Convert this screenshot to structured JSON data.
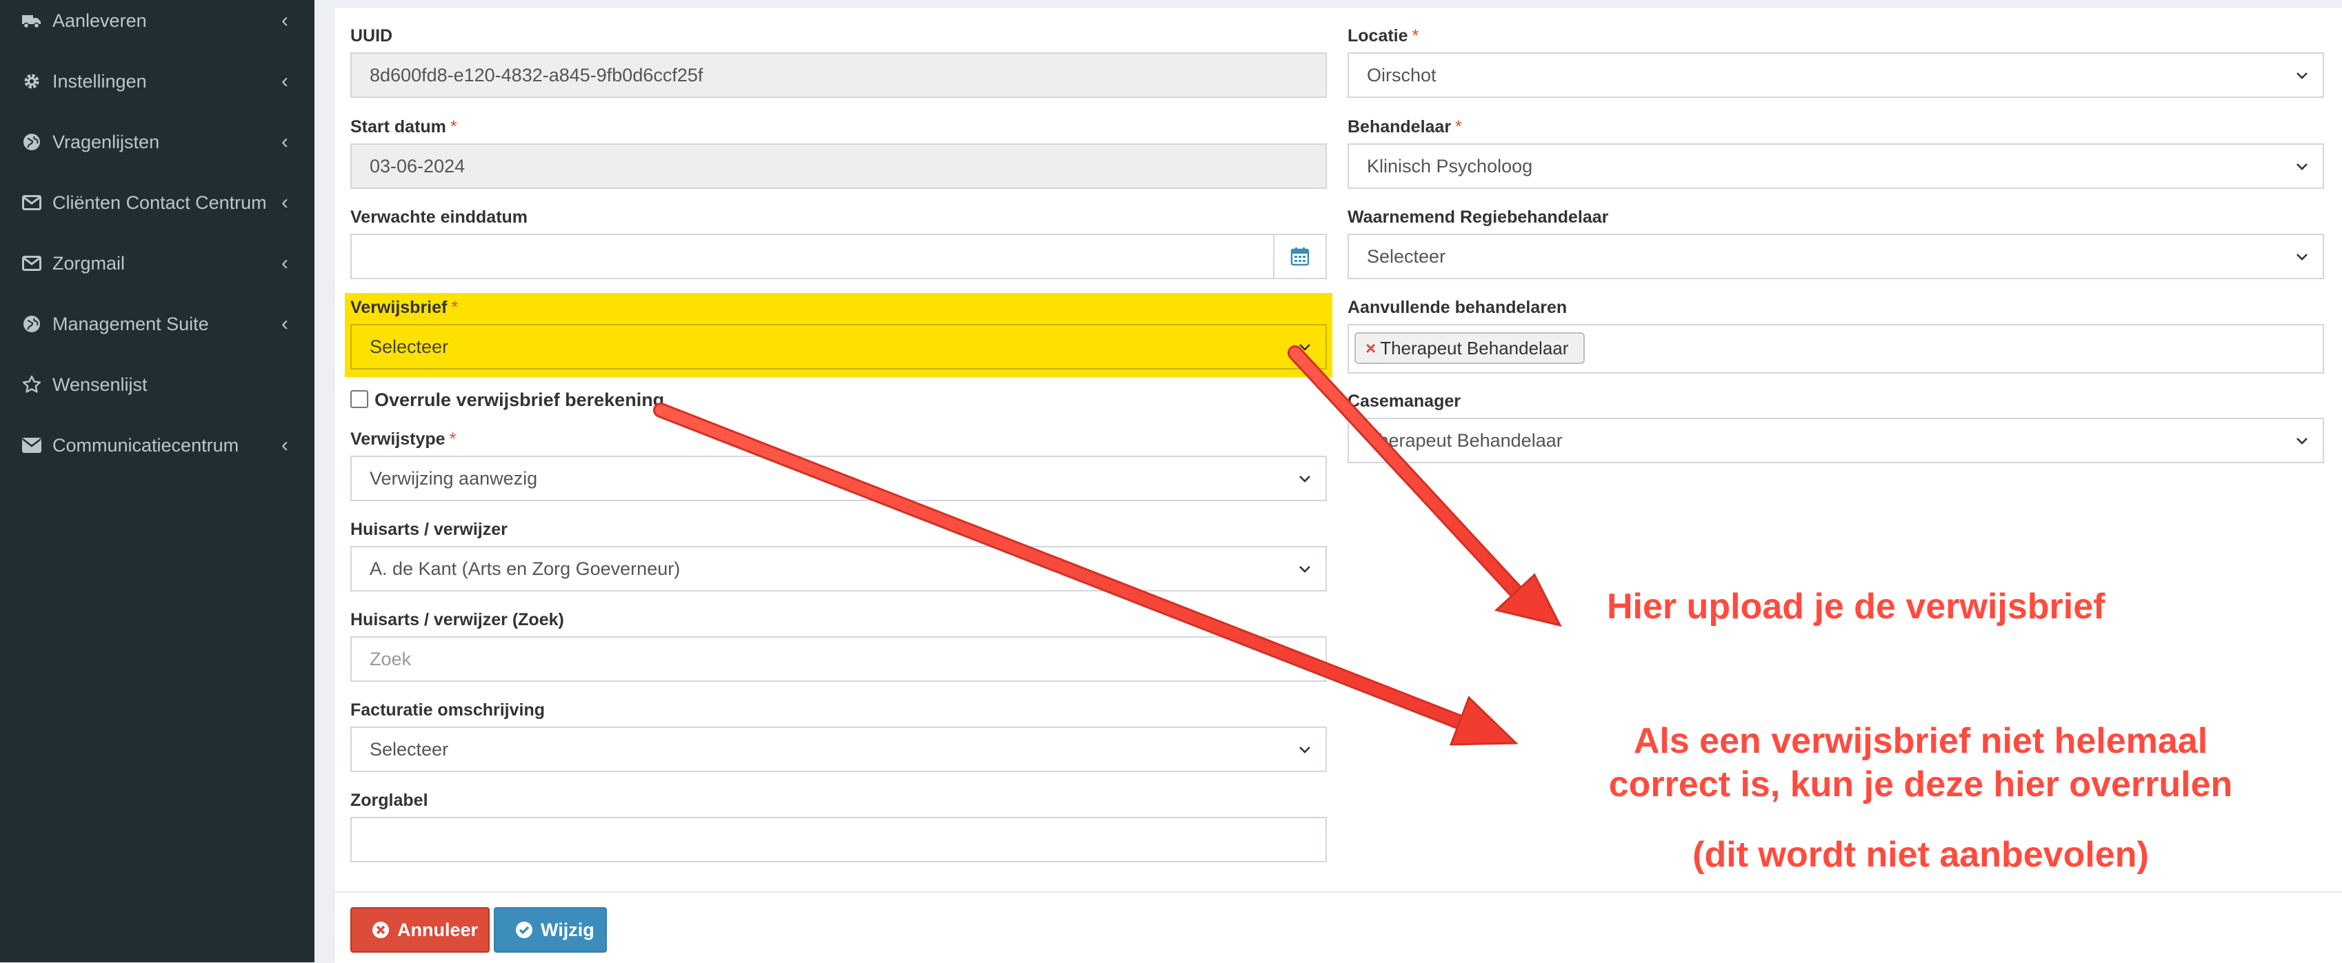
{
  "sidebar": {
    "items": [
      {
        "label": "Aanleveren",
        "icon": "truck-icon"
      },
      {
        "label": "Instellingen",
        "icon": "gear-icon"
      },
      {
        "label": "Vragenlijsten",
        "icon": "globe-icon"
      },
      {
        "label": "Cliënten Contact Centrum",
        "icon": "envelope-icon"
      },
      {
        "label": "Zorgmail",
        "icon": "envelope-icon"
      },
      {
        "label": "Management Suite",
        "icon": "globe-icon"
      },
      {
        "label": "Wensenlijst",
        "icon": "star-icon"
      },
      {
        "label": "Communicatiecentrum",
        "icon": "envelope-icon"
      }
    ]
  },
  "form": {
    "uuid": {
      "label": "UUID",
      "value": "8d600fd8-e120-4832-a845-9fb0d6ccf25f"
    },
    "start_datum": {
      "label": "Start datum",
      "value": "03-06-2024"
    },
    "verwachte_einddatum": {
      "label": "Verwachte einddatum",
      "value": ""
    },
    "verwijsbrief": {
      "label": "Verwijsbrief",
      "value": "Selecteer"
    },
    "overrule": {
      "label": "Overrule verwijsbrief berekening",
      "checked": false
    },
    "verwijstype": {
      "label": "Verwijstype",
      "value": "Verwijzing aanwezig"
    },
    "huisarts": {
      "label": "Huisarts / verwijzer",
      "value": "A. de Kant (Arts en Zorg Goeverneur)"
    },
    "huisarts_zoek": {
      "label": "Huisarts / verwijzer (Zoek)",
      "placeholder": "Zoek"
    },
    "facturatie": {
      "label": "Facturatie omschrijving",
      "value": "Selecteer"
    },
    "zorglabel": {
      "label": "Zorglabel",
      "value": ""
    },
    "locatie": {
      "label": "Locatie",
      "value": "Oirschot"
    },
    "behandelaar": {
      "label": "Behandelaar",
      "value": "Klinisch Psycholoog"
    },
    "waarnemend": {
      "label": "Waarnemend Regiebehandelaar",
      "value": "Selecteer"
    },
    "aanvullende": {
      "label": "Aanvullende behandelaren",
      "tags": [
        "Therapeut Behandelaar"
      ],
      "remove_symbol": "×"
    },
    "casemanager": {
      "label": "Casemanager",
      "value": "Therapeut Behandelaar"
    },
    "required_marker": "*"
  },
  "buttons": {
    "cancel": "Annuleer",
    "save": "Wijzig"
  },
  "annotations": {
    "upload": "Hier upload je de verwijsbrief",
    "overrule_line1": "Als een verwijsbrief niet helemaal",
    "overrule_line2": "correct is, kun je deze hier overrulen",
    "overrule_line3": "(dit wordt niet aanbevolen)"
  },
  "colors": {
    "sidebar_bg": "#222d32",
    "highlight": "#ffe100",
    "annotation": "#ff4b3e",
    "danger": "#dd4b39",
    "primary": "#3c8dbc"
  }
}
